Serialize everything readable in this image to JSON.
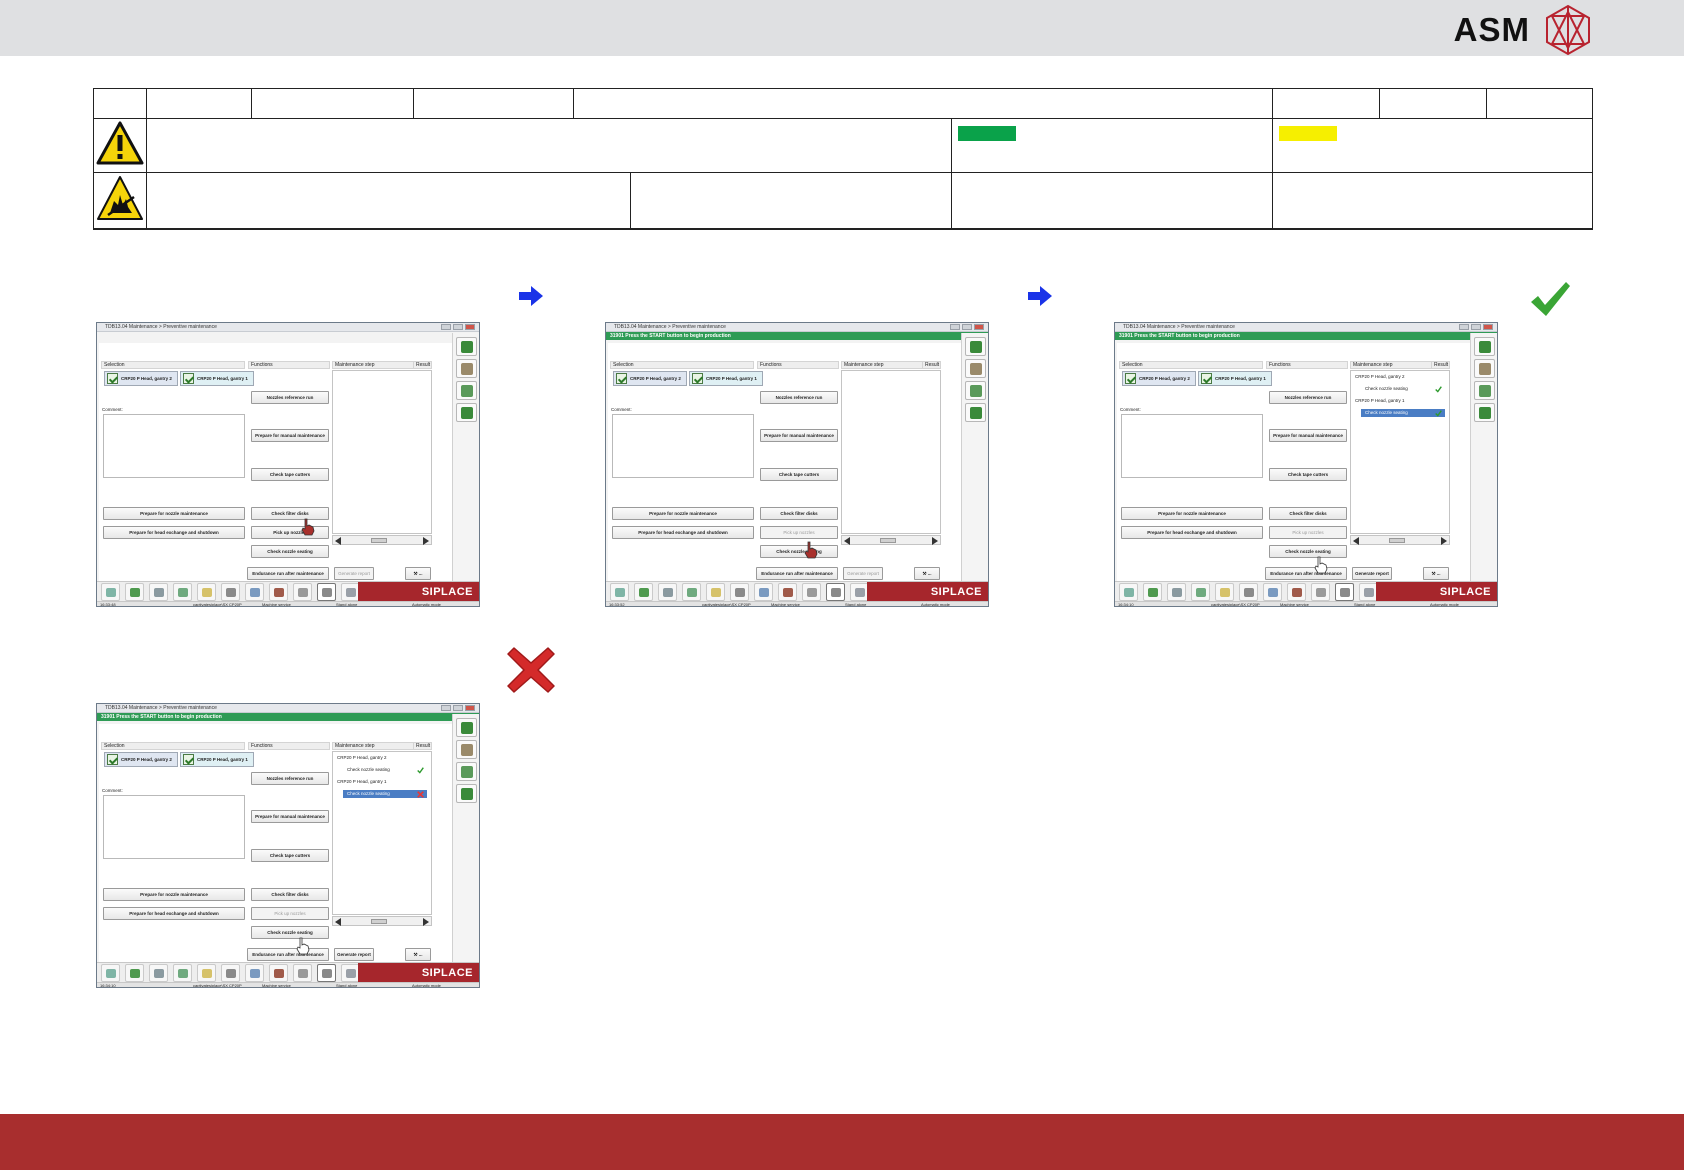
{
  "brand": {
    "name": "ASM",
    "logo_icon": "asm-star-logo-icon",
    "logo_color": "#b8232f"
  },
  "colors": {
    "top_band": "#dfe0e2",
    "bottom_band": "#a82e2e",
    "swatch_green": "#0aa24a",
    "swatch_yellow": "#f6ef00",
    "arrow_blue": "#1a33e8",
    "check_green": "#3aa535",
    "cross_red": "#d42a2a"
  },
  "table": {
    "warning_icon": "warning-triangle-icon",
    "esd_icon": "esd-hand-icon"
  },
  "steps": {
    "arrow_icon": "arrow-right-icon",
    "success_icon": "checkmark-icon",
    "fail_icon": "cross-icon"
  },
  "shots": [
    {
      "title": "TDB13.04 Maintenance > Preventive maintenance",
      "status": "",
      "selection_label": "Selection",
      "functions_label": "Functions",
      "steps_label": "Maintenance step",
      "result_label": "Result",
      "tabs": [
        "CRP20 P Head, gantry 2",
        "CRP20 P Head, gantry 1"
      ],
      "comment_label": "Comment:",
      "buttons_left": [
        "Prepare for nozzle maintenance",
        "Prepare for head exchange and shutdown"
      ],
      "functions": [
        "Nozzles reference run",
        "Prepare for manual maintenance",
        "Check tape cutters",
        "Check filter disks",
        "Pick up nozzles",
        "Check nozzle seating",
        "Endurance run after maintenance"
      ],
      "report_button": "Generate report",
      "steps": [],
      "status_time": "16:33:48",
      "status_user": "captivatesiplace\\SX CP20P",
      "status_service": "Machine service",
      "status_stand": "Stand alone",
      "status_mode": "Automatic mode",
      "siplace_label": "SIPLACE"
    },
    {
      "title": "TDB13.04 Maintenance > Preventive maintenance",
      "status": "31901 Press the START button to begin production",
      "selection_label": "Selection",
      "functions_label": "Functions",
      "steps_label": "Maintenance step",
      "result_label": "Result",
      "tabs": [
        "CRP20 P Head, gantry 2",
        "CRP20 P Head, gantry 1"
      ],
      "comment_label": "Comment:",
      "buttons_left": [
        "Prepare for nozzle maintenance",
        "Prepare for head exchange and shutdown"
      ],
      "functions": [
        "Nozzles reference run",
        "Prepare for manual maintenance",
        "Check tape cutters",
        "Check filter disks",
        "Pick up nozzles",
        "Check nozzle seating",
        "Endurance run after maintenance"
      ],
      "report_button": "Generate report",
      "steps": [],
      "status_time": "16:33:52",
      "status_user": "captivatesiplace\\SX CP20P",
      "status_service": "Machine service",
      "status_stand": "Stand alone",
      "status_mode": "Automatic mode",
      "siplace_label": "SIPLACE"
    },
    {
      "title": "TDB13.04 Maintenance > Preventive maintenance",
      "status": "31901 Press the START button to begin production",
      "selection_label": "Selection",
      "functions_label": "Functions",
      "steps_label": "Maintenance step",
      "result_label": "Result",
      "tabs": [
        "CRP20 P Head, gantry 2",
        "CRP20 P Head, gantry 1"
      ],
      "comment_label": "Comment:",
      "buttons_left": [
        "Prepare for nozzle maintenance",
        "Prepare for head exchange and shutdown"
      ],
      "functions": [
        "Nozzles reference run",
        "Prepare for manual maintenance",
        "Check tape cutters",
        "Check filter disks",
        "Pick up nozzles",
        "Check nozzle seating",
        "Endurance run after maintenance"
      ],
      "report_button": "Generate report",
      "steps": [
        "CRP20 P Head, gantry 2",
        "Check nozzle seating",
        "CRP20 P Head, gantry 1",
        "Check nozzle seating"
      ],
      "status_time": "16:34:10",
      "status_user": "captivatesiplace\\SX CP20P",
      "status_service": "Machine service",
      "status_stand": "Stand alone",
      "status_mode": "Automatic mode",
      "siplace_label": "SIPLACE"
    },
    {
      "title": "TDB13.04 Maintenance > Preventive maintenance",
      "status": "31901 Press the START button to begin production",
      "selection_label": "Selection",
      "functions_label": "Functions",
      "steps_label": "Maintenance step",
      "result_label": "Result",
      "tabs": [
        "CRP20 P Head, gantry 2",
        "CRP20 P Head, gantry 1"
      ],
      "comment_label": "Comment:",
      "buttons_left": [
        "Prepare for nozzle maintenance",
        "Prepare for head exchange and shutdown"
      ],
      "functions": [
        "Nozzles reference run",
        "Prepare for manual maintenance",
        "Check tape cutters",
        "Check filter disks",
        "Pick up nozzles",
        "Check nozzle seating",
        "Endurance run after maintenance"
      ],
      "report_button": "Generate report",
      "steps": [
        "CRP20 P Head, gantry 2",
        "Check nozzle seating",
        "CRP20 P Head, gantry 1",
        "Check nozzle seating"
      ],
      "status_time": "16:34:10",
      "status_user": "captivatesiplace\\SX CP20P",
      "status_service": "Machine service",
      "status_stand": "Stand alone",
      "status_mode": "Automatic mode",
      "siplace_label": "SIPLACE"
    }
  ]
}
